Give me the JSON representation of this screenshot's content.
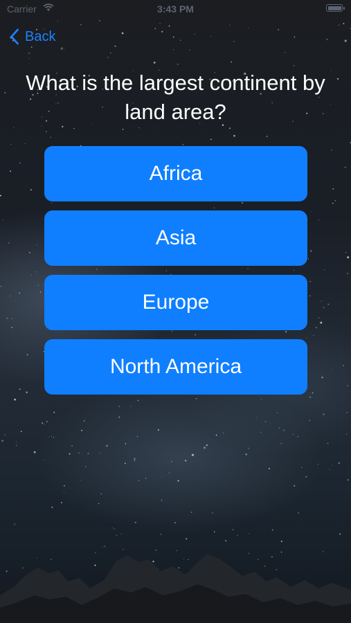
{
  "status_bar": {
    "carrier": "Carrier",
    "time": "3:43 PM",
    "wifi_icon": "wifi-icon",
    "battery_icon": "battery-icon"
  },
  "nav": {
    "back_label": "Back",
    "back_icon": "chevron-left-icon"
  },
  "question": {
    "text": "What is the largest continent by land area?"
  },
  "answers": [
    {
      "label": "Africa"
    },
    {
      "label": "Asia"
    },
    {
      "label": "Europe"
    },
    {
      "label": "North America"
    }
  ],
  "colors": {
    "accent": "#0f7fff",
    "link": "#1a82ff",
    "text": "#ffffff"
  }
}
